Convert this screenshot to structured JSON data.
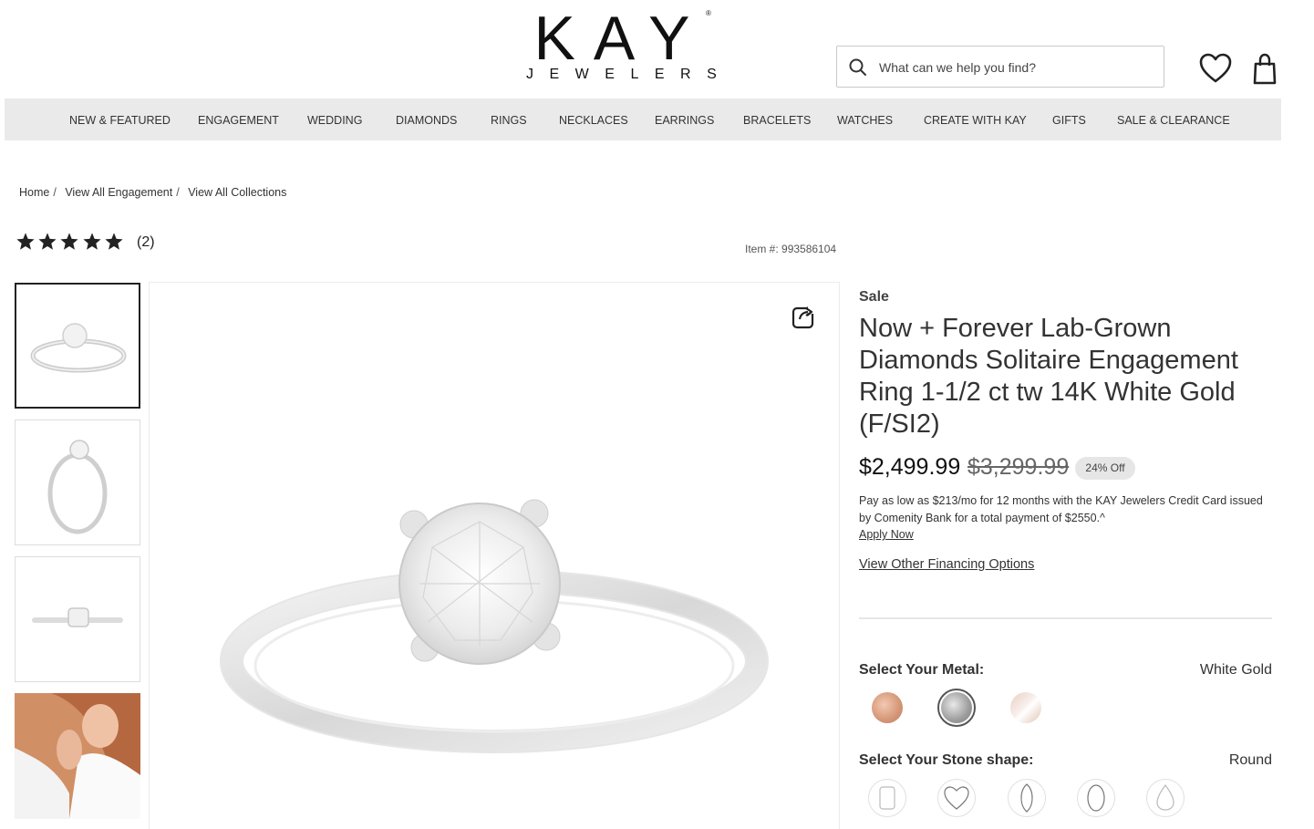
{
  "header": {
    "logo_main": "KAY",
    "logo_reg": "®",
    "logo_sub": "JEWELERS",
    "search_placeholder": "What can we help you find?"
  },
  "nav": {
    "items": [
      "NEW & FEATURED",
      "ENGAGEMENT",
      "WEDDING",
      "DIAMONDS",
      "RINGS",
      "NECKLACES",
      "EARRINGS",
      "BRACELETS",
      "WATCHES",
      "CREATE WITH KAY",
      "GIFTS",
      "SALE & CLEARANCE"
    ]
  },
  "breadcrumb": [
    "Home",
    "View All Engagement",
    "View All Collections"
  ],
  "breadcrumb_sep": "/",
  "rating": {
    "stars": 5,
    "count": "(2)"
  },
  "item_number": "Item #: 993586104",
  "product": {
    "sale_label": "Sale",
    "title": "Now + Forever Lab-Grown Diamonds Solitaire Engagement Ring 1-1/2 ct tw 14K White Gold (F/SI2)",
    "price": "$2,499.99",
    "old_price": "$3,299.99",
    "discount": "24% Off",
    "financing_text": "Pay as low as $213/mo for 12 months with the KAY Jewelers Credit Card issued by Comenity Bank for a total payment of $2550.^",
    "apply_now": "Apply Now",
    "other_financing": "View Other Financing Options"
  },
  "metal": {
    "label": "Select Your Metal:",
    "value": "White Gold",
    "swatches": [
      {
        "name": "rose-gold",
        "color": "#d9a58c"
      },
      {
        "name": "white-gold",
        "color": "#a8a8a8"
      },
      {
        "name": "two-tone",
        "color": "#ead4ca"
      }
    ]
  },
  "stone": {
    "label": "Select Your Stone shape:",
    "value": "Round",
    "shapes": [
      "emerald-cut",
      "heart",
      "marquise",
      "oval",
      "pear"
    ]
  }
}
